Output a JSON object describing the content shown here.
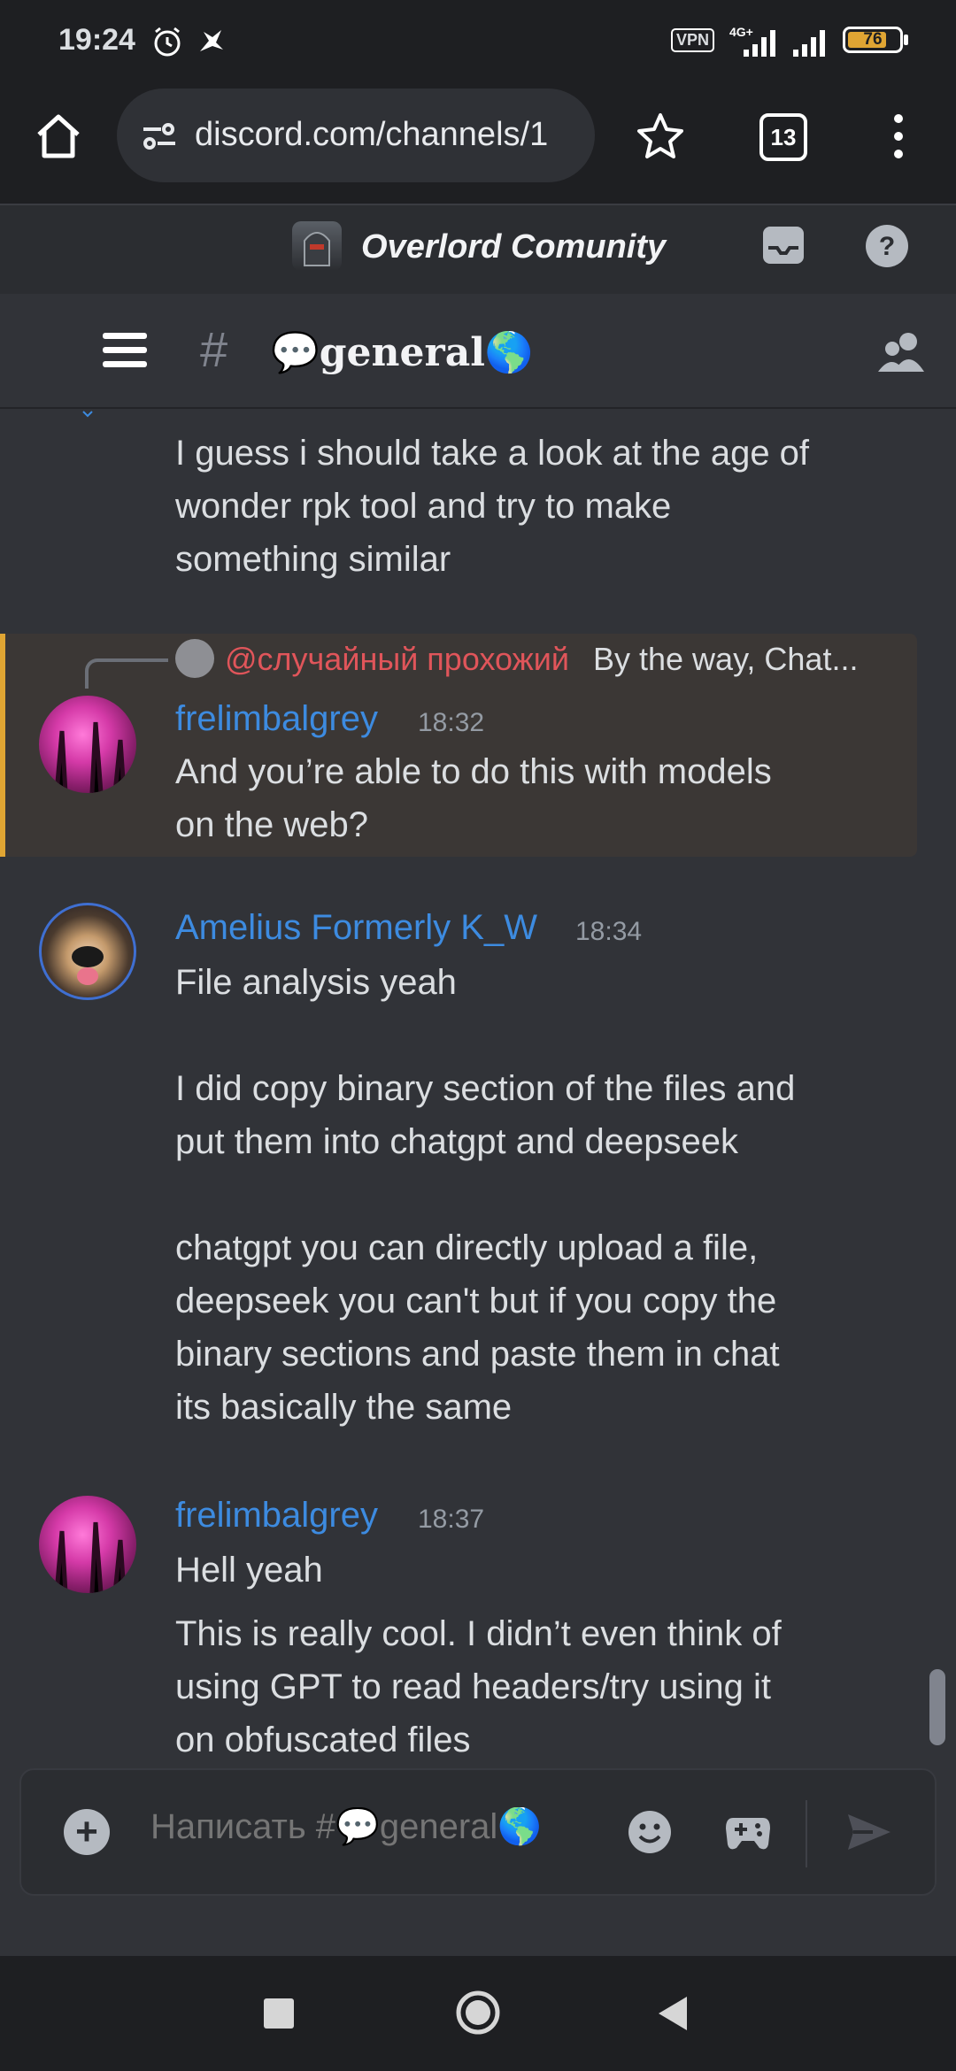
{
  "status_bar": {
    "time": "19:24",
    "vpn_label": "VPN",
    "network_label": "4G+",
    "battery_level": "76",
    "battery_fraction": 0.76
  },
  "browser": {
    "url": "discord.com/channels/1",
    "tab_count": "13"
  },
  "server": {
    "name": "Overlord Comunity"
  },
  "channel": {
    "hash": "#",
    "name": "💬general🌎"
  },
  "messages": [
    {
      "lines": [
        "I guess i should take a look at the age of",
        "wonder rpk tool and try to make",
        "something similar"
      ]
    },
    {
      "reply_mention": "@случайный прохожий",
      "reply_preview": "By the way, Chat...",
      "author": "frelimbalgrey",
      "time": "18:32",
      "lines": [
        "And you’re able to do this with models",
        "on the web?"
      ]
    },
    {
      "author": "Amelius Formerly K_W",
      "time": "18:34",
      "lines": [
        "File analysis yeah"
      ],
      "lines2": [
        "I did copy binary section of the files and",
        "put them into chatgpt and deepseek"
      ],
      "lines3": [
        "chatgpt you can directly upload a file,",
        "deepseek you can't but if you copy the",
        "binary sections and paste them in chat",
        "its basically the same"
      ]
    },
    {
      "author": "frelimbalgrey",
      "time": "18:37",
      "lines": [
        "Hell yeah"
      ],
      "lines2": [
        "This is really cool. I didn’t even think of",
        "using GPT to read headers/try using it",
        "on obfuscated files"
      ]
    }
  ],
  "composer": {
    "placeholder": "Написать #💬general🌎"
  },
  "icons": {
    "home": "home-icon",
    "bookmark": "star-icon",
    "menu": "more-vert-icon",
    "inbox": "inbox-icon",
    "help": "help-icon",
    "hamburger": "hamburger-icon",
    "members": "members-icon",
    "add": "plus-icon",
    "emoji": "emoji-icon",
    "apps": "gamepad-icon",
    "send": "send-icon"
  },
  "colors": {
    "author": "#3d8be0",
    "mention": "#e0555a",
    "highlight_bar": "#e0a533",
    "background": "#313338"
  }
}
